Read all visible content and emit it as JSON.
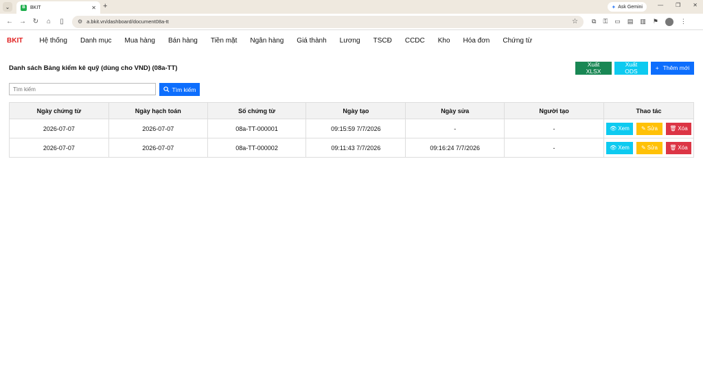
{
  "browser": {
    "tab_title": "BKIT",
    "tab_favicon": "B",
    "url": "a.bkit.vn/dashboard/document08a-tt",
    "ask_gemini": "Ask Gemini"
  },
  "app": {
    "brand": "BKIT",
    "menu": [
      "Hệ thống",
      "Danh mục",
      "Mua hàng",
      "Bán hàng",
      "Tiền mặt",
      "Ngân hàng",
      "Giá thành",
      "Lương",
      "TSCĐ",
      "CCDC",
      "Kho",
      "Hóa đơn",
      "Chứng từ"
    ]
  },
  "page": {
    "title": "Danh sách Bảng kiểm kê quỹ (dùng cho VND) (08a-TT)",
    "export_xlsx": "Xuất XLSX",
    "export_ods": "Xuất ODS",
    "add_new": "Thêm mới",
    "add_icon": "+"
  },
  "search": {
    "placeholder": "Tìm kiếm",
    "button": "Tìm kiếm"
  },
  "table": {
    "headers": [
      "Ngày chứng từ",
      "Ngày hạch toán",
      "Số chứng từ",
      "Ngày tạo",
      "Ngày sửa",
      "Người tạo",
      "Thao tác"
    ],
    "rows": [
      [
        "2026-07-07",
        "2026-07-07",
        "08a-TT-000001",
        "09:15:59 7/7/2026",
        "-",
        "-"
      ],
      [
        "2026-07-07",
        "2026-07-07",
        "08a-TT-000002",
        "09:11:43 7/7/2026",
        "09:16:24 7/7/2026",
        "-"
      ]
    ],
    "actions": {
      "view": "Xem",
      "edit": "Sửa",
      "delete": "Xóa"
    }
  }
}
